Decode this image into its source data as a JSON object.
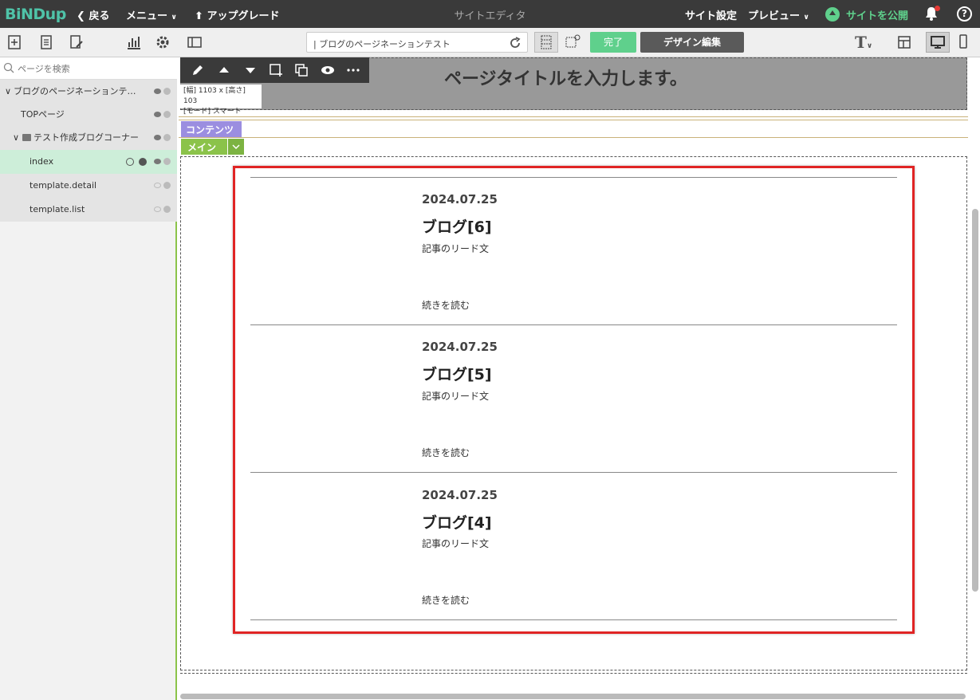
{
  "topbar": {
    "logo": "BiNDup",
    "back": "戻る",
    "menu": "メニュー",
    "upgrade": "アップグレード",
    "center_title": "サイトエディタ",
    "site_settings": "サイト設定",
    "preview": "プレビュー",
    "publish": "サイトを公開",
    "help": "?"
  },
  "toolbar": {
    "page_path": "| ブログのページネーションテスト",
    "done": "完了",
    "design_edit": "デザイン編集",
    "font_icon_label": "T"
  },
  "sidebar": {
    "search_placeholder": "ページを検索",
    "items": [
      {
        "label": "ブログのページネーションテ…",
        "indent": 0,
        "state": "grey"
      },
      {
        "label": "TOPページ",
        "indent": 1,
        "state": "grey"
      },
      {
        "label": "テスト作成ブログコーナー",
        "indent": 1,
        "state": "grey"
      },
      {
        "label": "index",
        "indent": 2,
        "state": "selected"
      },
      {
        "label": "template.detail",
        "indent": 2,
        "state": "grey"
      },
      {
        "label": "template.list",
        "indent": 2,
        "state": "grey"
      }
    ]
  },
  "canvas": {
    "page_title": "ページタイトルを入力します。",
    "size_info_line1": "[幅] 1103 x [高さ] 103",
    "size_info_line2": "[モード] スマート",
    "tag_contents": "コンテンツ",
    "tag_main": "メイン",
    "posts": [
      {
        "date": "2024.07.25",
        "title": "ブログ[6]",
        "lead": "記事のリード文",
        "more": "続きを読む"
      },
      {
        "date": "2024.07.25",
        "title": "ブログ[5]",
        "lead": "記事のリード文",
        "more": "続きを読む"
      },
      {
        "date": "2024.07.25",
        "title": "ブログ[4]",
        "lead": "記事のリード文",
        "more": "続きを読む"
      }
    ]
  },
  "colors": {
    "accent_green": "#5fd08c",
    "logo": "#4fc3a8",
    "highlight_red": "#e02424",
    "contents_tag": "#9b8ee0",
    "main_tag": "#8bc34a"
  }
}
